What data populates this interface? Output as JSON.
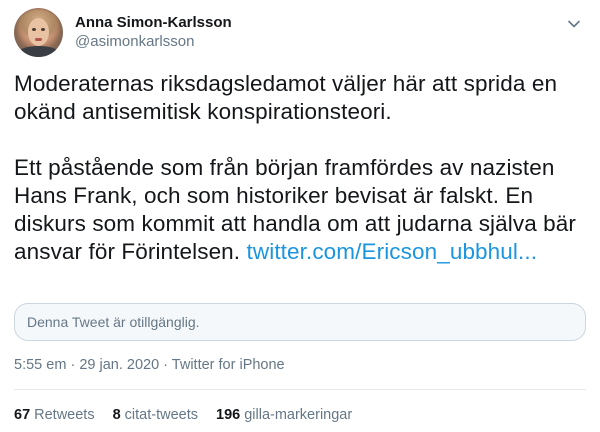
{
  "author": {
    "name": "Anna Simon-Karlsson",
    "handle": "@asimonkarlsson"
  },
  "tweet": {
    "paragraph1": "Moderaternas riksdagsledamot väljer här att sprida en okänd antisemitisk konspirationsteori.",
    "paragraph2": "Ett påstående som från början framfördes av nazisten Hans Frank, och som historiker bevisat är falskt. En diskurs som kommit att handla om att judarna själva bär ansvar för Förintelsen.",
    "link": "twitter.com/Ericson_ubbhul..."
  },
  "quoted_tweet": {
    "text": "Denna Tweet är otillgänglig."
  },
  "meta": {
    "time": "5:55 em",
    "separator": "·",
    "date": "29 jan. 2020",
    "source": "Twitter for iPhone"
  },
  "stats": {
    "retweets_count": "67",
    "retweets_label": "Retweets",
    "quotes_count": "8",
    "quotes_label": "citat-tweets",
    "likes_count": "196",
    "likes_label": "gilla-markeringar"
  },
  "colors": {
    "link": "#1b95e0",
    "secondary_text": "#657786",
    "primary_text": "#14171a",
    "border": "#ccd6dd"
  }
}
